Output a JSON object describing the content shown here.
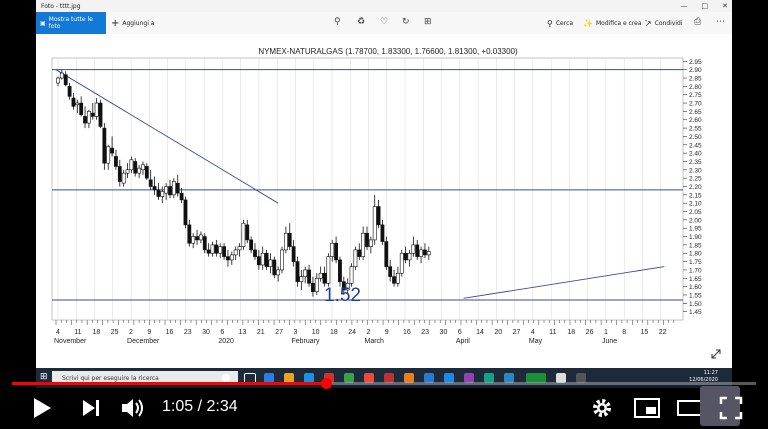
{
  "window": {
    "title": "Foto - tttt.jpg"
  },
  "toolbar": {
    "all_photos_label": "Mostra tutte le foto",
    "add_label": "Aggiungi a",
    "search_label": "Cerca",
    "edit_label": "Modifica e crea",
    "share_label": "Condividi"
  },
  "chart_data": {
    "type": "candlestick",
    "title": "NYMEX-NATURALGAS (1.78700, 1.83300, 1.76600, 1.81300, +0.03300)",
    "annotation": "1.52",
    "ylim": [
      1.4,
      2.97
    ],
    "y_ticks": [
      "2.95",
      "2.90",
      "2.85",
      "2.80",
      "2.75",
      "2.70",
      "2.65",
      "2.60",
      "2.55",
      "2.50",
      "2.45",
      "2.40",
      "2.35",
      "2.30",
      "2.25",
      "2.20",
      "2.15",
      "2.10",
      "2.05",
      "2.00",
      "1.95",
      "1.90",
      "1.85",
      "1.80",
      "1.75",
      "1.70",
      "1.65",
      "1.60",
      "1.55",
      "1.50",
      "1.45"
    ],
    "x_ticks": [
      "4",
      "11",
      "18",
      "25",
      "2",
      "9",
      "16",
      "23",
      "30",
      "6",
      "13",
      "21",
      "27",
      "3",
      "10",
      "18",
      "24",
      "2",
      "9",
      "16",
      "23",
      "30",
      "6",
      "14",
      "20",
      "27",
      "4",
      "11",
      "18",
      "26",
      "1",
      "8",
      "15",
      "22"
    ],
    "x_months": [
      "November",
      "December",
      "2020",
      "February",
      "March",
      "April",
      "May",
      "June"
    ],
    "horizontal_levels": [
      2.9,
      2.18,
      1.52
    ],
    "trendlines": [
      {
        "from": [
          0,
          2.9
        ],
        "to": [
          57,
          2.1
        ]
      },
      {
        "from": [
          105,
          1.53
        ],
        "to": [
          157,
          1.72
        ]
      }
    ],
    "grid": true,
    "candles": [
      [
        2.82,
        2.86,
        2.8,
        2.85
      ],
      [
        2.85,
        2.9,
        2.84,
        2.88
      ],
      [
        2.87,
        2.89,
        2.8,
        2.81
      ],
      [
        2.8,
        2.82,
        2.72,
        2.74
      ],
      [
        2.73,
        2.76,
        2.66,
        2.68
      ],
      [
        2.69,
        2.72,
        2.64,
        2.7
      ],
      [
        2.7,
        2.74,
        2.62,
        2.63
      ],
      [
        2.62,
        2.68,
        2.55,
        2.58
      ],
      [
        2.58,
        2.66,
        2.55,
        2.65
      ],
      [
        2.64,
        2.7,
        2.6,
        2.62
      ],
      [
        2.62,
        2.73,
        2.6,
        2.7
      ],
      [
        2.7,
        2.72,
        2.55,
        2.56
      ],
      [
        2.55,
        2.58,
        2.3,
        2.34
      ],
      [
        2.34,
        2.45,
        2.3,
        2.44
      ],
      [
        2.43,
        2.5,
        2.38,
        2.4
      ],
      [
        2.38,
        2.42,
        2.3,
        2.32
      ],
      [
        2.32,
        2.36,
        2.2,
        2.23
      ],
      [
        2.22,
        2.3,
        2.2,
        2.28
      ],
      [
        2.28,
        2.34,
        2.25,
        2.3
      ],
      [
        2.3,
        2.38,
        2.28,
        2.36
      ],
      [
        2.35,
        2.37,
        2.26,
        2.28
      ],
      [
        2.28,
        2.33,
        2.25,
        2.31
      ],
      [
        2.3,
        2.35,
        2.27,
        2.33
      ],
      [
        2.32,
        2.34,
        2.24,
        2.25
      ],
      [
        2.24,
        2.3,
        2.18,
        2.2
      ],
      [
        2.2,
        2.26,
        2.15,
        2.18
      ],
      [
        2.18,
        2.22,
        2.12,
        2.14
      ],
      [
        2.14,
        2.2,
        2.1,
        2.17
      ],
      [
        2.16,
        2.22,
        2.12,
        2.2
      ],
      [
        2.2,
        2.24,
        2.13,
        2.15
      ],
      [
        2.15,
        2.25,
        2.13,
        2.23
      ],
      [
        2.22,
        2.27,
        2.14,
        2.16
      ],
      [
        2.16,
        2.19,
        2.1,
        2.12
      ],
      [
        2.12,
        2.14,
        1.95,
        1.97
      ],
      [
        1.97,
        2.0,
        1.84,
        1.86
      ],
      [
        1.86,
        1.92,
        1.83,
        1.9
      ],
      [
        1.9,
        1.94,
        1.85,
        1.88
      ],
      [
        1.88,
        1.93,
        1.86,
        1.91
      ],
      [
        1.9,
        1.92,
        1.8,
        1.82
      ],
      [
        1.82,
        1.86,
        1.78,
        1.8
      ],
      [
        1.8,
        1.87,
        1.78,
        1.85
      ],
      [
        1.85,
        1.88,
        1.78,
        1.8
      ],
      [
        1.8,
        1.86,
        1.77,
        1.84
      ],
      [
        1.84,
        1.86,
        1.76,
        1.78
      ],
      [
        1.78,
        1.82,
        1.72,
        1.76
      ],
      [
        1.76,
        1.81,
        1.73,
        1.79
      ],
      [
        1.79,
        1.84,
        1.76,
        1.82
      ],
      [
        1.82,
        1.86,
        1.78,
        1.84
      ],
      [
        1.84,
        2.0,
        1.82,
        1.98
      ],
      [
        1.97,
        2.0,
        1.86,
        1.88
      ],
      [
        1.88,
        1.9,
        1.8,
        1.82
      ],
      [
        1.82,
        1.86,
        1.76,
        1.78
      ],
      [
        1.78,
        1.82,
        1.7,
        1.73
      ],
      [
        1.73,
        1.84,
        1.7,
        1.8
      ],
      [
        1.8,
        1.82,
        1.7,
        1.72
      ],
      [
        1.72,
        1.8,
        1.68,
        1.76
      ],
      [
        1.76,
        1.78,
        1.65,
        1.67
      ],
      [
        1.67,
        1.72,
        1.63,
        1.7
      ],
      [
        1.7,
        1.84,
        1.68,
        1.82
      ],
      [
        1.82,
        1.96,
        1.8,
        1.92
      ],
      [
        1.92,
        1.98,
        1.82,
        1.84
      ],
      [
        1.84,
        1.88,
        1.72,
        1.75
      ],
      [
        1.75,
        1.78,
        1.6,
        1.63
      ],
      [
        1.63,
        1.7,
        1.58,
        1.66
      ],
      [
        1.66,
        1.72,
        1.62,
        1.7
      ],
      [
        1.7,
        1.73,
        1.6,
        1.62
      ],
      [
        1.62,
        1.66,
        1.54,
        1.57
      ],
      [
        1.57,
        1.68,
        1.55,
        1.65
      ],
      [
        1.65,
        1.72,
        1.63,
        1.68
      ],
      [
        1.68,
        1.72,
        1.6,
        1.62
      ],
      [
        1.62,
        1.8,
        1.6,
        1.78
      ],
      [
        1.78,
        1.88,
        1.75,
        1.86
      ],
      [
        1.86,
        1.9,
        1.74,
        1.76
      ],
      [
        1.76,
        1.78,
        1.6,
        1.63
      ],
      [
        1.63,
        1.66,
        1.55,
        1.58
      ],
      [
        1.58,
        1.65,
        1.56,
        1.62
      ],
      [
        1.62,
        1.74,
        1.6,
        1.72
      ],
      [
        1.72,
        1.84,
        1.7,
        1.82
      ],
      [
        1.82,
        1.86,
        1.76,
        1.78
      ],
      [
        1.78,
        1.96,
        1.76,
        1.92
      ],
      [
        1.92,
        1.96,
        1.82,
        1.84
      ],
      [
        1.84,
        1.9,
        1.8,
        1.88
      ],
      [
        1.88,
        2.15,
        1.85,
        2.08
      ],
      [
        2.08,
        2.12,
        1.95,
        1.97
      ],
      [
        1.97,
        2.0,
        1.85,
        1.87
      ],
      [
        1.87,
        1.9,
        1.7,
        1.72
      ],
      [
        1.72,
        1.76,
        1.63,
        1.66
      ],
      [
        1.66,
        1.7,
        1.6,
        1.62
      ],
      [
        1.62,
        1.72,
        1.6,
        1.68
      ],
      [
        1.68,
        1.82,
        1.66,
        1.8
      ],
      [
        1.8,
        1.84,
        1.74,
        1.76
      ],
      [
        1.76,
        1.82,
        1.72,
        1.8
      ],
      [
        1.8,
        1.9,
        1.78,
        1.85
      ],
      [
        1.85,
        1.88,
        1.76,
        1.78
      ],
      [
        1.78,
        1.84,
        1.74,
        1.82
      ],
      [
        1.82,
        1.86,
        1.77,
        1.79
      ],
      [
        1.79,
        1.84,
        1.76,
        1.81
      ]
    ]
  },
  "taskbar": {
    "search_placeholder": "Scrivi qui per eseguire la ricerca",
    "clock_time": "11:27",
    "clock_date": "12/06/2020"
  },
  "player": {
    "time": "1:05 / 2:34",
    "progress": 0.422
  }
}
